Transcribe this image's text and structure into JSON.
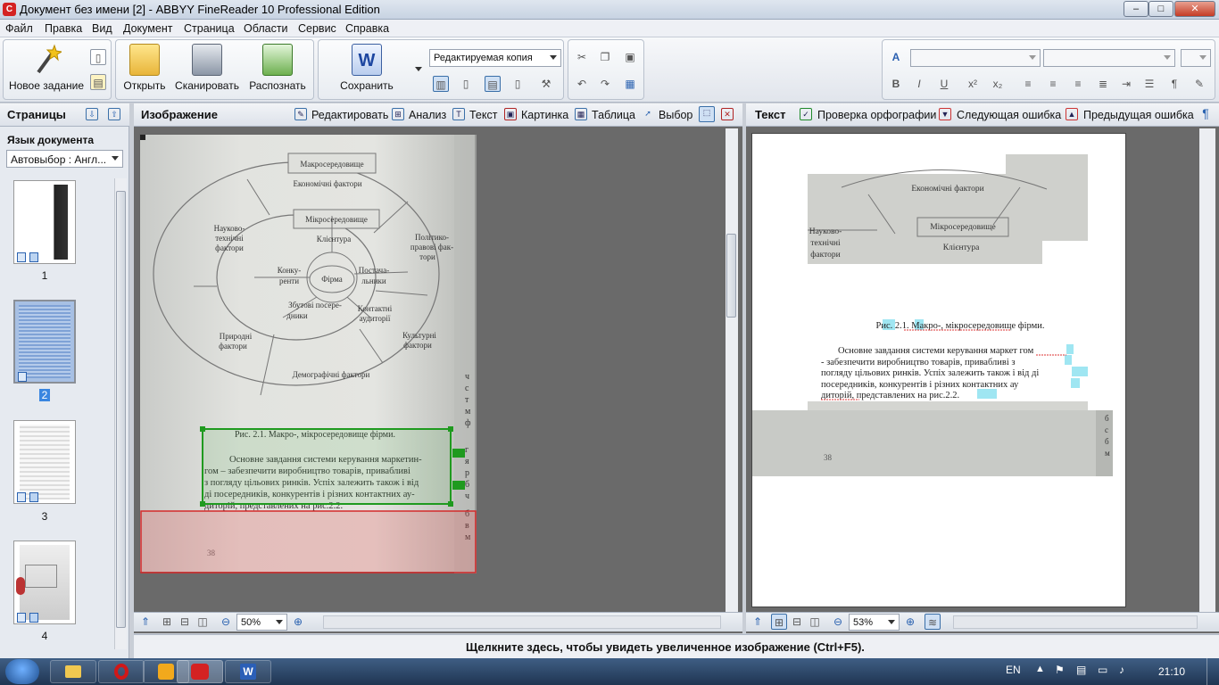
{
  "window": {
    "title": "Документ без имени [2] - ABBYY FineReader 10 Professional Edition",
    "minimize": "–",
    "maximize": "□",
    "close": "✕"
  },
  "menu": [
    "Файл",
    "Правка",
    "Вид",
    "Документ",
    "Страница",
    "Области",
    "Сервис",
    "Справка"
  ],
  "toolbar": {
    "new_task": "Новое задание",
    "open": "Открыть",
    "scan": "Сканировать",
    "recognize": "Распознать",
    "save": "Сохранить",
    "save_format": "Редактируемая копия",
    "font_name": "",
    "font_size": ""
  },
  "pages_pane": {
    "title": "Страницы",
    "language_label": "Язык документа",
    "language_value": "Автовыбор : Англ...",
    "pages": [
      "1",
      "2",
      "3",
      "4"
    ],
    "selected_page": "2"
  },
  "image_pane": {
    "title": "Изображение",
    "tools": [
      "Редактировать",
      "Анализ",
      "Текст",
      "Картинка",
      "Таблица",
      "Выбор"
    ],
    "zoom": "50%"
  },
  "text_pane": {
    "title": "Текст",
    "tools": [
      "Проверка орфографии",
      "Следующая ошибка",
      "Предыдущая ошибка"
    ],
    "zoom": "53%"
  },
  "document": {
    "diagram": {
      "macro": "Макросередовище",
      "economic": "Економічні фактори",
      "micro": "Мікросередовище",
      "clients": "Клієнтура",
      "scitech": [
        "Науково-",
        "технічні",
        "фактори"
      ],
      "political": [
        "Політико-",
        "правові фак-",
        "тори"
      ],
      "competitors": [
        "Конку-",
        "ренти"
      ],
      "firm": "Фірма",
      "suppliers": [
        "Постача-",
        "льники"
      ],
      "sales": [
        "Збутові посере-",
        "дники"
      ],
      "audiences": [
        "Контактні",
        "аудиторії"
      ],
      "natural": [
        "Природні",
        "фактори"
      ],
      "cultural": [
        "Культурні",
        "фактори"
      ],
      "demographic": "Демографічні фактори"
    },
    "caption": "Рис. 2.1. Макро-, мікросередовище фірми.",
    "paragraph": [
      "Основне завдання системи керування маркетин-",
      "гом – забезпечити виробництво товарів, привабливі",
      "з погляду цільових ринків. Успіх залежить також і від",
      "ді посередників, конкурентів і різних контактних ау-",
      "диторій, представлених на рис.2.2."
    ],
    "page_number": "38",
    "margin_letters": [
      "ч",
      "с",
      "т",
      "м",
      "ф",
      "г",
      "я",
      "р",
      "б",
      "ч",
      "б",
      "в",
      "м"
    ]
  },
  "recognized": {
    "top_labels": {
      "economic": "Економічні фактори",
      "micro": "Мікросередовище",
      "scitech": [
        "Науково-",
        "технічні",
        "фактори"
      ],
      "clients": "Клієнтура"
    },
    "caption": "Рис. 2.1. Макро-, мікросередовище фірми.",
    "paragraph": [
      "Основне завдання системи керування маркет гом",
      "- забезпечити виробництво товарів, привабливі з",
      "погляду цільових ринків. Успіх залежить також і від ді",
      "посередників, конкурентів і різних контактних ау",
      "диторій, представлених на рис.2.2."
    ],
    "page_number": "38",
    "margin_letters": [
      "б",
      "с",
      "б",
      "м"
    ]
  },
  "status": {
    "message": "Щелкните здесь, чтобы увидеть увеличенное изображение (Ctrl+F5)."
  },
  "taskbar": {
    "lang": "EN",
    "time": "21:10"
  }
}
